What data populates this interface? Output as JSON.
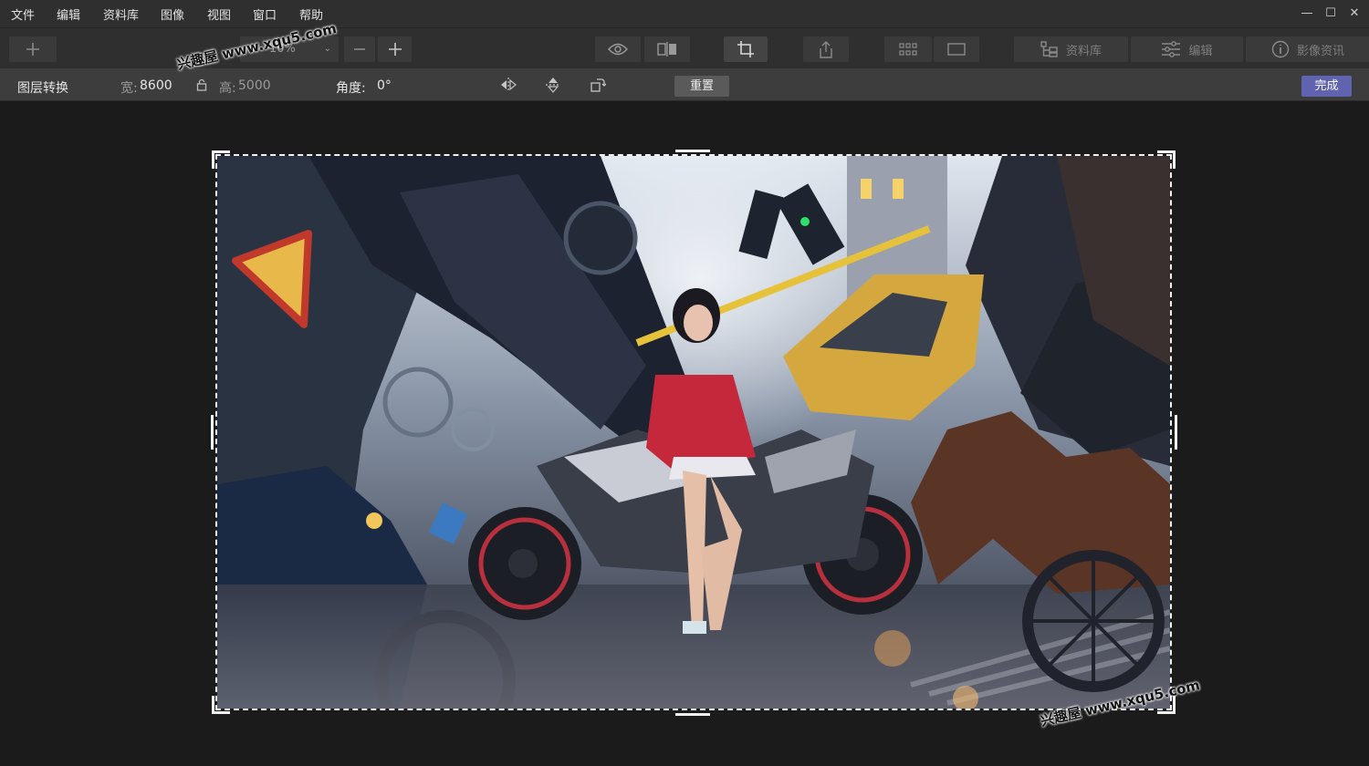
{
  "menu": {
    "items": [
      "文件",
      "编辑",
      "资料库",
      "图像",
      "视图",
      "窗口",
      "帮助"
    ]
  },
  "window_controls": {
    "minimize": "—",
    "maximize": "☐",
    "close": "✕"
  },
  "toolbar": {
    "add_icon": "plus-icon",
    "zoom_value": "10%",
    "zoom_out_icon": "minus-icon",
    "zoom_in_icon": "plus-icon",
    "preview_icon": "eye-icon",
    "compare_icon": "split-compare-icon",
    "crop_icon": "crop-icon",
    "share_icon": "share-icon",
    "grid_view_icon": "grid-icon",
    "single_view_icon": "single-view-icon",
    "library_label": "资料库",
    "edit_label": "编辑",
    "info_label": "影像资讯"
  },
  "transform": {
    "title": "图层转换",
    "width_label": "宽:",
    "width_value": "8600",
    "height_label": "高:",
    "height_value": "5000",
    "angle_label": "角度:",
    "angle_value": "0°",
    "reset_label": "重置",
    "done_label": "完成"
  },
  "watermark": {
    "text": "兴趣屋 www.xqu5.com"
  },
  "colors": {
    "accent": "#5f63b0",
    "background": "#1b1b1b",
    "toolbar": "#2f2f2f"
  }
}
